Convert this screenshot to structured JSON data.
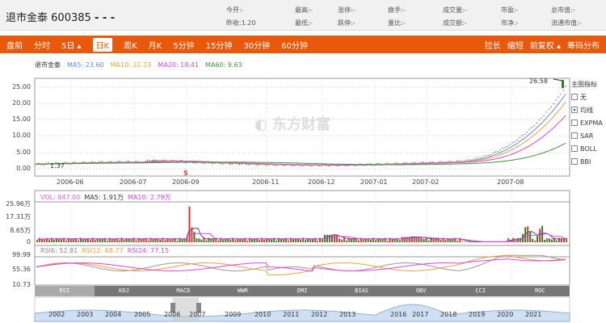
{
  "header": {
    "name": "退市金泰",
    "code": "600385",
    "change": "- - -",
    "quotes": [
      {
        "label": "今开:",
        "value": "-"
      },
      {
        "label": "最高:",
        "value": "-"
      },
      {
        "label": "涨停:",
        "value": "-"
      },
      {
        "label": "换手:",
        "value": "-"
      },
      {
        "label": "成交量:",
        "value": "-"
      },
      {
        "label": "市盈:",
        "value": "-"
      },
      {
        "label": "总市值:",
        "value": "-"
      },
      {
        "label": "昨收:",
        "value": "1.20"
      },
      {
        "label": "最低:",
        "value": "-"
      },
      {
        "label": "跌停:",
        "value": "-"
      },
      {
        "label": "量比:",
        "value": "-"
      },
      {
        "label": "成交额:",
        "value": "-"
      },
      {
        "label": "市净:",
        "value": "-"
      },
      {
        "label": "流通市值:",
        "value": "-"
      }
    ]
  },
  "toolbar": {
    "periods": [
      "盘前",
      "分时",
      "5日 ▴",
      "日K",
      "周K",
      "月K",
      "5分钟",
      "15分钟",
      "30分钟",
      "60分钟"
    ],
    "active": "日K",
    "right": [
      "拉长",
      "缩短",
      "前复权 ▴",
      "筹码分布"
    ]
  },
  "main": {
    "name": "退市金泰",
    "ma5": "MA5: 23.60",
    "ma10": "MA10: 22.23",
    "ma20": "MA20: 18.41",
    "ma60": "MA60: 9.63",
    "yticks": [
      "25.00",
      "20.00",
      "15.00",
      "10.00",
      "5.00",
      "0.00"
    ],
    "xticks": [
      "2006-06",
      "2006-07",
      "2006-09",
      "2006-11",
      "2006-12",
      "2007-01",
      "2007-02",
      "2007-08"
    ],
    "high_label": "26.58",
    "low_label": "1.37",
    "marker": "S",
    "watermark": "东方财富"
  },
  "indicators": {
    "title": "主图指标",
    "items": [
      {
        "label": "无",
        "checked": false
      },
      {
        "label": "均线",
        "checked": true
      },
      {
        "label": "EXPMA",
        "checked": false
      },
      {
        "label": "SAR",
        "checked": false
      },
      {
        "label": "BOLL",
        "checked": false
      },
      {
        "label": "BBI",
        "checked": false
      }
    ]
  },
  "volume": {
    "vol": "VOL: 847.00",
    "ma5": "MA5: 1.91万",
    "ma10": "MA10: 2.79万",
    "yticks": [
      "25.96万",
      "17.31万",
      "8.65万",
      "0"
    ]
  },
  "rsi": {
    "rsi6": "RSI6: 52.81",
    "rsi12": "RSI12: 68.77",
    "rsi24": "RSI24: 77.15",
    "yticks": [
      "99.99",
      "55.36",
      "10.73"
    ]
  },
  "tabs": [
    "RSI",
    "KDJ",
    "MACD",
    "WWR",
    "DMI",
    "BIAS",
    "OBV",
    "CCI",
    "ROC"
  ],
  "navigator": {
    "years": [
      "2002",
      "2003",
      "2004",
      "2005",
      "2006",
      "2007",
      "2009",
      "2010",
      "2011",
      "2012",
      "2013",
      "2016",
      "2017",
      "2018",
      "2019",
      "2020",
      "2021"
    ]
  },
  "colors": {
    "accent": "#e8590c",
    "ma5": "#5b8def",
    "ma10": "#e8a33c",
    "ma20": "#e040e0",
    "ma60": "#3a9a3a",
    "up": "#e8303a",
    "down": "#1a8a1a"
  }
}
